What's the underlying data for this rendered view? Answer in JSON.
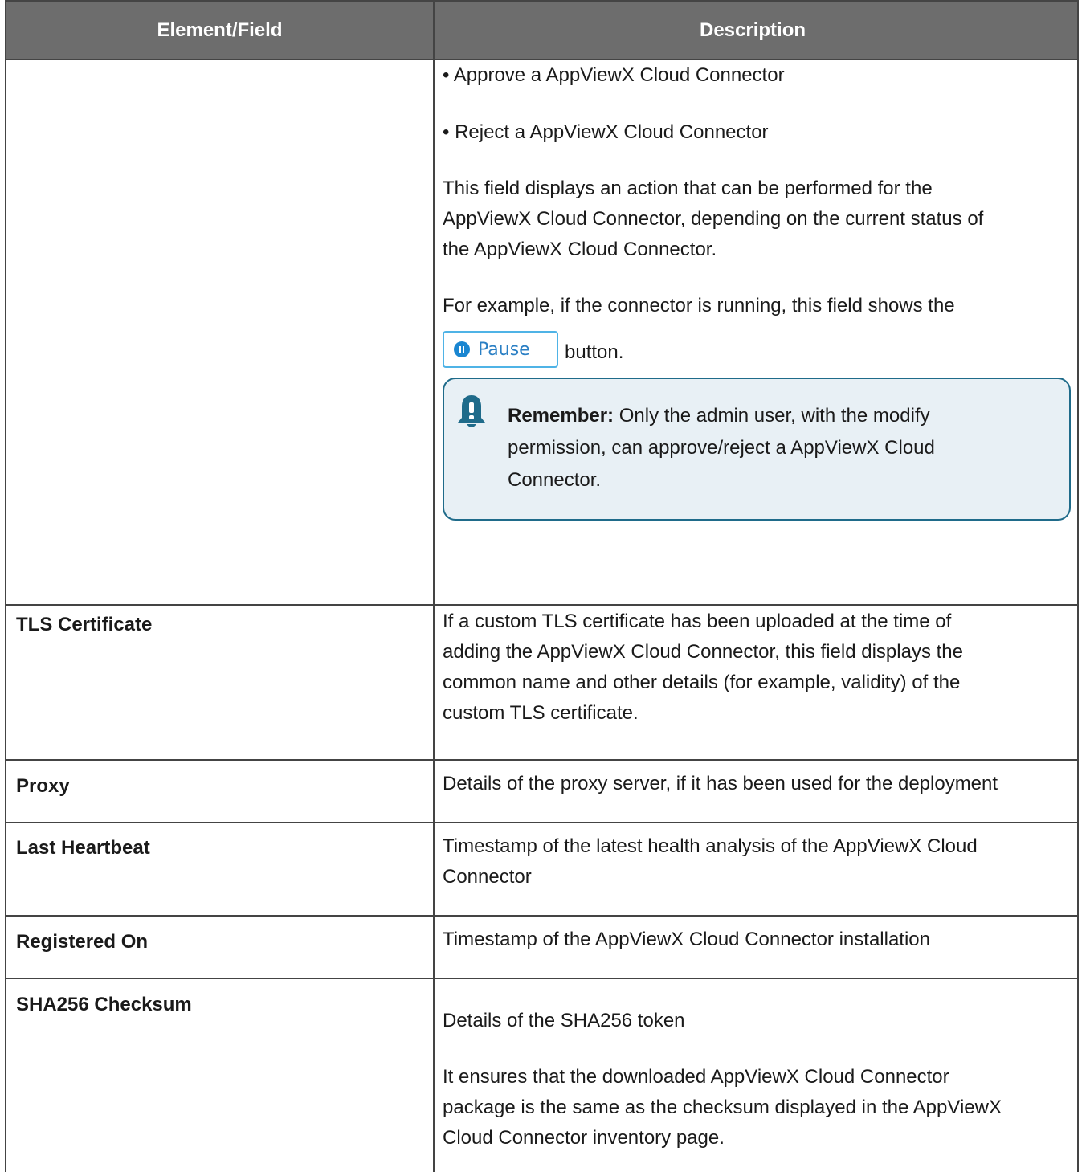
{
  "header": {
    "col1": "Element/Field",
    "col2": "Description"
  },
  "action_row": {
    "bullets": [
      "• Approve a AppViewX Cloud Connector",
      "• Reject a AppViewX Cloud Connector"
    ],
    "para1_lines": [
      "This field displays an action that can be performed for the",
      "AppViewX Cloud Connector, depending on the current status of",
      "the AppViewX Cloud Connector."
    ],
    "para2": "For example, if the connector is running, this field shows the",
    "pause_button_label": "Pause",
    "pause_icon": "pause-circle-icon",
    "after_button": "button.",
    "note": {
      "icon": "bell-icon",
      "label": "Remember:",
      "lines": [
        " Only the admin user, with the modify",
        "permission, can approve/reject a AppViewX Cloud",
        "Connector."
      ]
    }
  },
  "rows": [
    {
      "field": "TLS Certificate",
      "desc_lines": [
        "If a custom TLS certificate has been uploaded at the time of",
        "adding the AppViewX Cloud Connector, this field displays the",
        "common name and other details (for example, validity) of the",
        "custom TLS certificate."
      ]
    },
    {
      "field": "Proxy",
      "desc_lines": [
        "Details of the proxy server, if it has been used for the deployment"
      ]
    },
    {
      "field": "Last Heartbeat",
      "desc_lines": [
        "Timestamp of the latest health analysis of the AppViewX Cloud",
        "Connector"
      ]
    },
    {
      "field": "Registered On",
      "desc_lines": [
        "Timestamp of the AppViewX Cloud Connector installation"
      ]
    },
    {
      "field": "SHA256 Checksum",
      "desc_lines": [
        "Details of the SHA256 token"
      ],
      "desc2_lines": [
        "It ensures that the downloaded AppViewX Cloud Connector",
        "package is the same as the checksum displayed in the AppViewX",
        "Cloud Connector inventory page."
      ]
    }
  ],
  "colors": {
    "header_bg": "#6d6d6d",
    "note_bg": "#e8f0f5",
    "note_border": "#1f6b8a",
    "button_border": "#4fb3e6"
  }
}
